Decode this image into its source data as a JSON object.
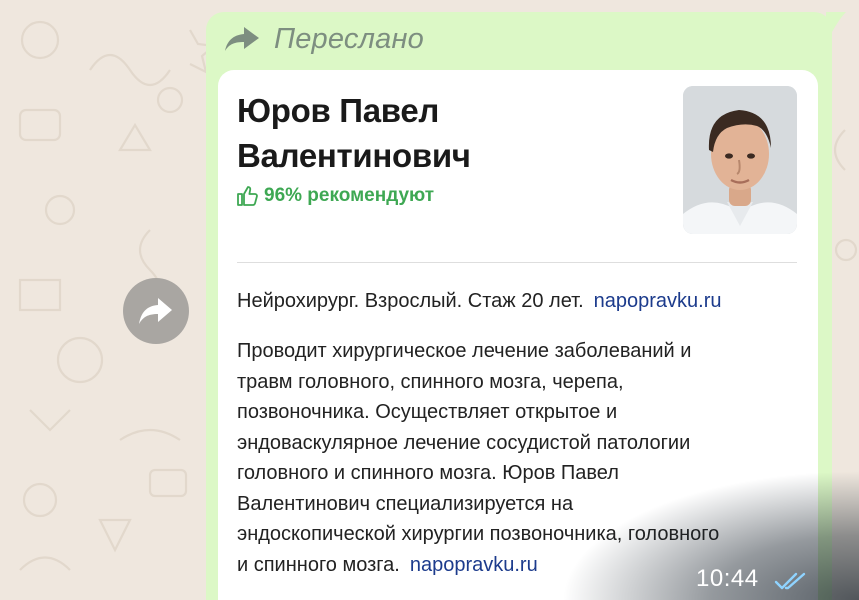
{
  "message": {
    "forwarded_label": "Переслано",
    "time": "10:44",
    "status_icon": "double-check-read-icon"
  },
  "card": {
    "name_line1": "Юров Павел",
    "name_line2": "Валентинович",
    "recommend_text": "96% рекомендуют",
    "recommend_icon": "thumbs-up-icon",
    "photo_alt": "doctor-portrait",
    "specialty": "Нейрохирург. Взрослый. Стаж 20 лет.",
    "source_link": "napopravku.ru",
    "description_lines": [
      "Проводит хирургическое лечение заболеваний и",
      "травм головного, спинного мозга, черепа,",
      "позвоночника. Осуществляет открытое и",
      "эндоваскулярное лечение сосудистой патологии",
      "головного и спинного мозга. Юров Павел",
      "Валентинович специализируется на",
      "эндоскопической хирургии позвоночника, головного",
      "и спинного мозга."
    ],
    "description_link": "napopravku.ru"
  },
  "colors": {
    "bubble": "#dcf8c6",
    "accent_green": "#3ea853",
    "link_blue": "#1c3b8c",
    "wallpaper": "#efe7de"
  },
  "icons": {
    "forward_button": "share-forward-icon",
    "forward_header": "forward-arrow-icon"
  }
}
